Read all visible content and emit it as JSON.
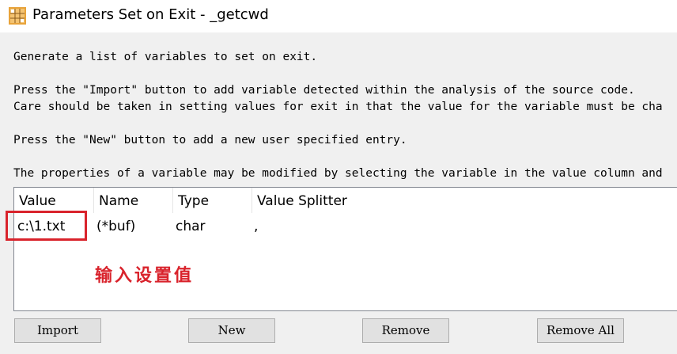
{
  "window": {
    "title": "Parameters Set on Exit - _getcwd",
    "icon": "grid-app-icon"
  },
  "description": {
    "line1": "Generate a list of variables to set on exit.",
    "line2": "Press the \"Import\" button to add variable detected within the analysis of the source code.",
    "line3": "Care should be taken in setting values for exit in that the value for the variable must be cha",
    "line4": "Press the \"New\" button to add a new user specified entry.",
    "line5": "The properties of a variable may be modified by selecting the variable in the value column and"
  },
  "table": {
    "columns": [
      "Value",
      "Name",
      "Type",
      "Value Splitter"
    ],
    "rows": [
      {
        "value": "c:\\1.txt",
        "name": "(*buf)",
        "type": "char",
        "splitter": ","
      }
    ]
  },
  "annotation": {
    "text": "输入设置值",
    "color": "#d9232c"
  },
  "buttons": {
    "import": "Import",
    "new": "New",
    "remove": "Remove",
    "remove_all": "Remove All"
  }
}
